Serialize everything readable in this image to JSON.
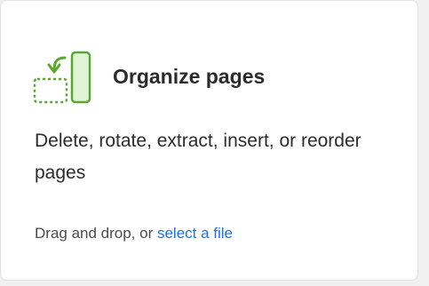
{
  "card": {
    "title": "Organize pages",
    "description": "Delete, rotate, extract, insert, or reorder pages",
    "drop_text": "Drag and drop, or ",
    "link_text": "select a file",
    "icon": "organize-pages-icon"
  },
  "colors": {
    "icon_green": "#5aa832",
    "icon_fill": "#e2f4d6",
    "link_blue": "#1473e6",
    "text": "#2c2c2c"
  }
}
